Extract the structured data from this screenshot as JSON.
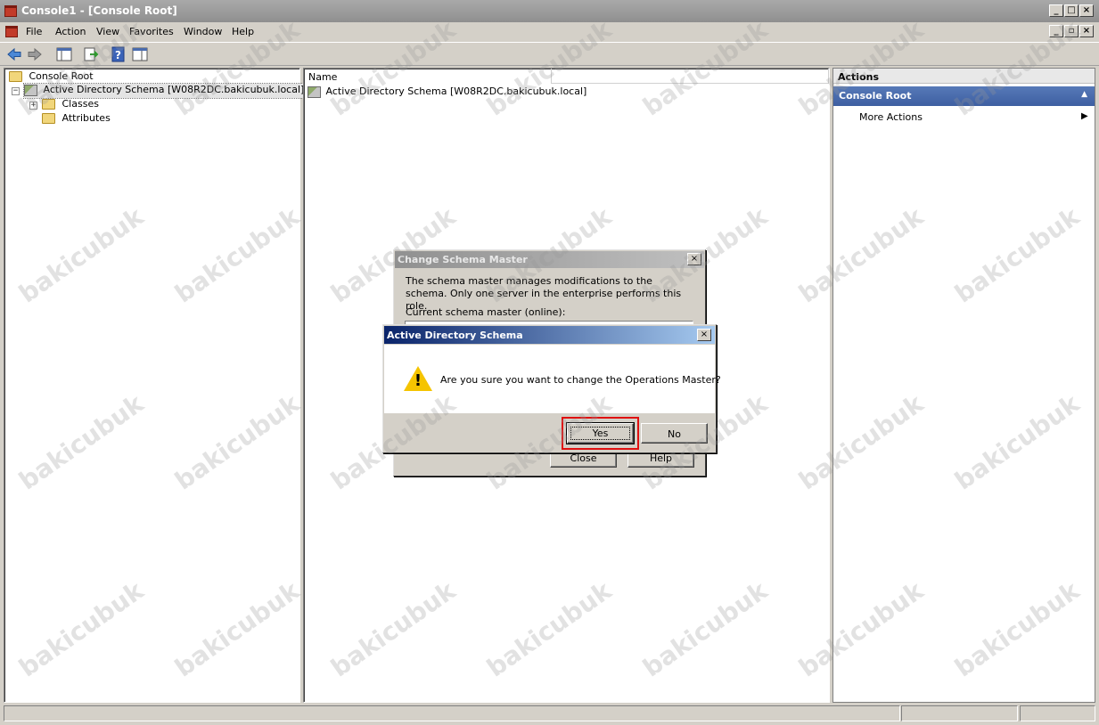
{
  "window": {
    "title": "Console1 - [Console Root]",
    "controls": {
      "minimize": "_",
      "maximize": "□",
      "close": "×",
      "restore": "▫"
    }
  },
  "menu": {
    "items": [
      "File",
      "Action",
      "View",
      "Favorites",
      "Window",
      "Help"
    ]
  },
  "toolbar": {
    "icons": [
      "back-arrow-icon",
      "forward-arrow-icon",
      "show-hide-tree-icon",
      "export-list-icon",
      "help-icon",
      "show-action-pane-icon"
    ],
    "help_glyph": "?"
  },
  "tree": {
    "root": "Console Root",
    "node": "Active Directory Schema [W08R2DC.bakicubuk.local]",
    "children": [
      "Classes",
      "Attributes"
    ],
    "collapse_glyph": "−",
    "expand_glyph": "+"
  },
  "list": {
    "column_name": "Name",
    "items": [
      "Active Directory Schema [W08R2DC.bakicubuk.local]"
    ]
  },
  "actions": {
    "header": "Actions",
    "section": "Console Root",
    "section_arrow": "▲",
    "items": [
      "More Actions"
    ],
    "item_arrow": "▶"
  },
  "dialog_schema_master": {
    "title": "Change Schema Master",
    "description": "The schema master manages modifications to the schema. Only one server in the enterprise performs this role.",
    "current_label": "Current schema master (online):",
    "buttons": {
      "close": "Close",
      "help": "Help"
    }
  },
  "dialog_confirm": {
    "title": "Active Directory Schema",
    "message": "Are you sure you want to change the Operations Master?",
    "warn_glyph": "!",
    "buttons": {
      "yes": "Yes",
      "no": "No"
    }
  },
  "watermark": "bakicubuk",
  "colors": {
    "accent_active_title": "#0a246a",
    "actions_section": "#4a6cae",
    "highlight": "#e01010",
    "warning": "#f5c400"
  }
}
